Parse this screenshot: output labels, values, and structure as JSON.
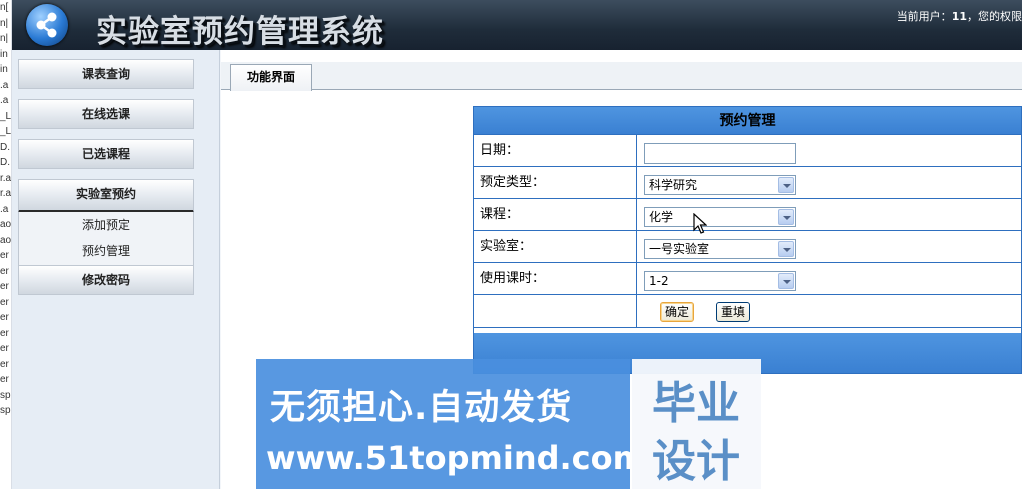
{
  "left_strip": [
    "n[",
    "n|",
    "n|",
    "in",
    "in",
    ".a",
    ".a",
    "_L",
    "_L",
    "D.",
    "D.",
    "r.a",
    "r.a",
    ".a",
    "ao",
    "ao",
    "er",
    "er",
    "er",
    "er",
    "er",
    "er",
    "er",
    "er",
    "er",
    "sp",
    "sp"
  ],
  "header": {
    "title": "实验室预约管理系统",
    "user_prefix": "当前用户：",
    "user_name": "11",
    "user_suffix": "，您的权限"
  },
  "sidebar": {
    "items": [
      {
        "label": "课表查询"
      },
      {
        "label": "在线选课"
      },
      {
        "label": "已选课程"
      },
      {
        "label": "实验室预约"
      },
      {
        "label": "修改密码"
      }
    ],
    "submenu": [
      {
        "label": "添加预定"
      },
      {
        "label": "预约管理"
      }
    ]
  },
  "tab": {
    "label": "功能界面"
  },
  "form": {
    "title": "预约管理",
    "date_label": "日期：",
    "date_value": "",
    "type_label": "预定类型：",
    "type_value": "科学研究",
    "course_label": "课程：",
    "course_value": "化学",
    "lab_label": "实验室：",
    "lab_value": "一号实验室",
    "hours_label": "使用课时：",
    "hours_value": "1-2",
    "confirm_label": "确定",
    "reset_label": "重填"
  },
  "watermark": {
    "line1": "无须担心.自动发货",
    "line2": "www.51topmind.com",
    "right1": "毕业",
    "right2": "设计"
  }
}
